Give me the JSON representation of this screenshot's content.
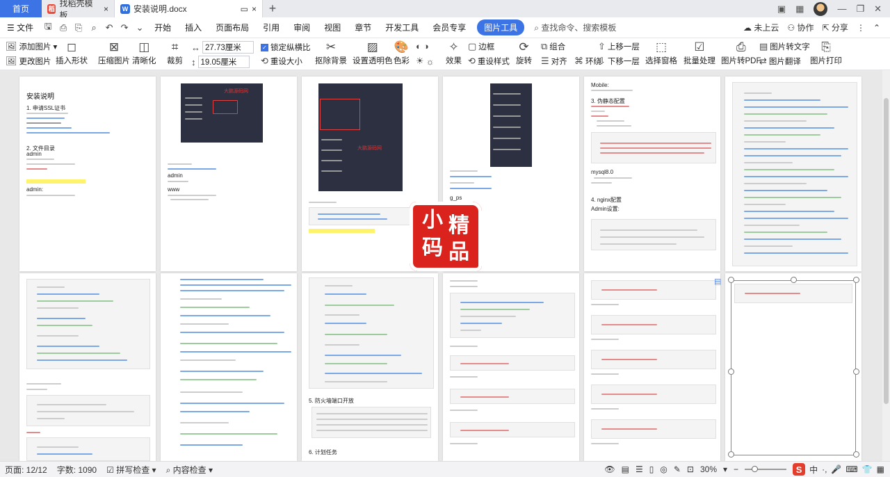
{
  "tabs": {
    "home": "首页",
    "template_tab": "找稻壳模板",
    "doc_tab": "安装说明.docx"
  },
  "menu": {
    "file": "文件",
    "items": [
      "开始",
      "插入",
      "页面布局",
      "引用",
      "审阅",
      "视图",
      "章节",
      "开发工具",
      "会员专享"
    ],
    "active_tab": "图片工具",
    "search": "查找命令、搜索模板",
    "cloud": "未上云",
    "collab": "协作",
    "share": "分享"
  },
  "ribbon": {
    "add_image": "添加图片",
    "change_image": "更改图片",
    "insert_shape": "插入形状",
    "compress": "压缩图片",
    "sharpen": "清晰化",
    "crop": "裁剪",
    "width": "27.73厘米",
    "height": "19.05厘米",
    "lock_ratio": "锁定纵横比",
    "reset_size": "重设大小",
    "remove_bg": "抠除背景",
    "set_transparent": "设置透明色",
    "color": "色彩",
    "effect": "效果",
    "border": "边框",
    "reset_style": "重设样式",
    "group": "组合",
    "rotate": "旋转",
    "align": "对齐",
    "wrap": "环绕",
    "bring_forward": "上移一层",
    "send_backward": "下移一层",
    "selection_pane": "选择窗格",
    "batch": "批量处理",
    "to_pdf": "图片转PDF",
    "to_text": "图片转文字",
    "translate": "图片翻译",
    "print": "图片打印"
  },
  "pages": {
    "p1": {
      "title": "安装说明",
      "h1": "1. 申请SSL证书",
      "h2": "2. 文件目录",
      "admin1": "admin",
      "admin2": "admin:"
    },
    "p2": {
      "admin": "admin",
      "www": "www"
    },
    "p4": {
      "g": "g_ps"
    },
    "p5": {
      "mobile": "Mobile:",
      "h3": "3. 伪静态配置",
      "mysql": "mysql8.0",
      "h4": "4. nginx配置",
      "admin": "Admin设置:"
    },
    "p9": {
      "h5": "5. 防火墙端口开放",
      "h6": "6. 计划任务"
    }
  },
  "watermark": {
    "brand": "大鹏源码网"
  },
  "seal": {
    "c1": "小",
    "c2": "精",
    "c3": "码",
    "c4": "品"
  },
  "status": {
    "page": "页面: 12/12",
    "words": "字数: 1090",
    "spell": "拼写检查",
    "content": "内容检查",
    "zoom": "30%",
    "ime_lang": "中"
  }
}
